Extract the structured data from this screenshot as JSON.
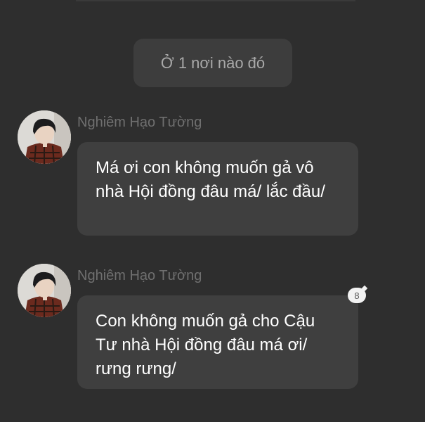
{
  "system_message": "Ở 1 nơi nào đó",
  "messages": [
    {
      "sender": "Nghiêm Hạo Tường",
      "text": "Má ơi con không muốn gả vô nhà Hội đồng đâu má/ lắc đầu/"
    },
    {
      "sender": "Nghiêm Hạo Tường",
      "text": "Con không muốn gả cho Cậu Tư nhà Hội đồng đâu má ơi/ rưng rưng/",
      "comment_count": "8"
    }
  ],
  "colors": {
    "background": "#2e2e2e",
    "bubble": "#3f3f3f",
    "system_pill": "#3d3d3d",
    "sender_name": "#6f6f6f",
    "message_text": "#ffffff"
  }
}
